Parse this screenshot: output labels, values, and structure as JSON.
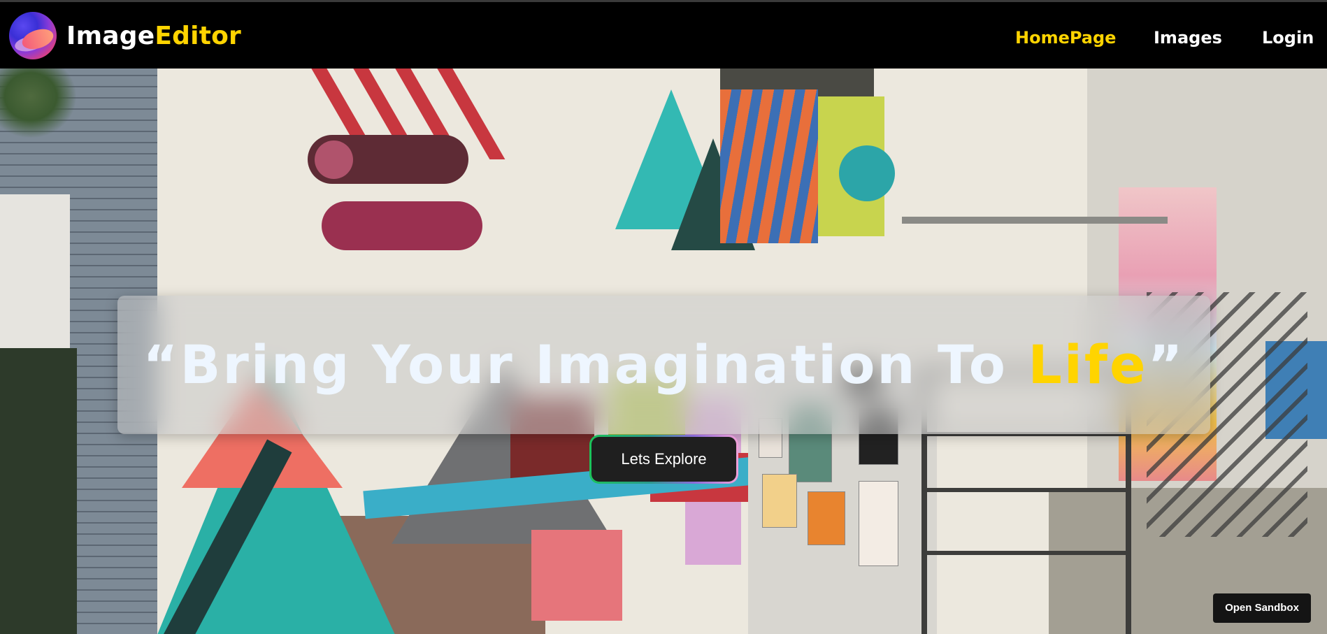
{
  "nav": {
    "brand_primary": "Image",
    "brand_accent": "Editor",
    "links": [
      "HomePage",
      "Images",
      "Login"
    ],
    "active_link": "HomePage"
  },
  "hero": {
    "quote_open": "“Bring Your Imagination To ",
    "quote_highlight": "Life",
    "quote_close": "”",
    "cta_label": "Lets Explore"
  },
  "sandbox_label": "Open Sandbox",
  "colors": {
    "accent": "#ffd400",
    "navbar_bg": "#000000",
    "text_light": "#eef6ff",
    "button_bg": "#1f1f1f"
  },
  "icons": {
    "logo": "gradient-orb-logo-icon"
  }
}
